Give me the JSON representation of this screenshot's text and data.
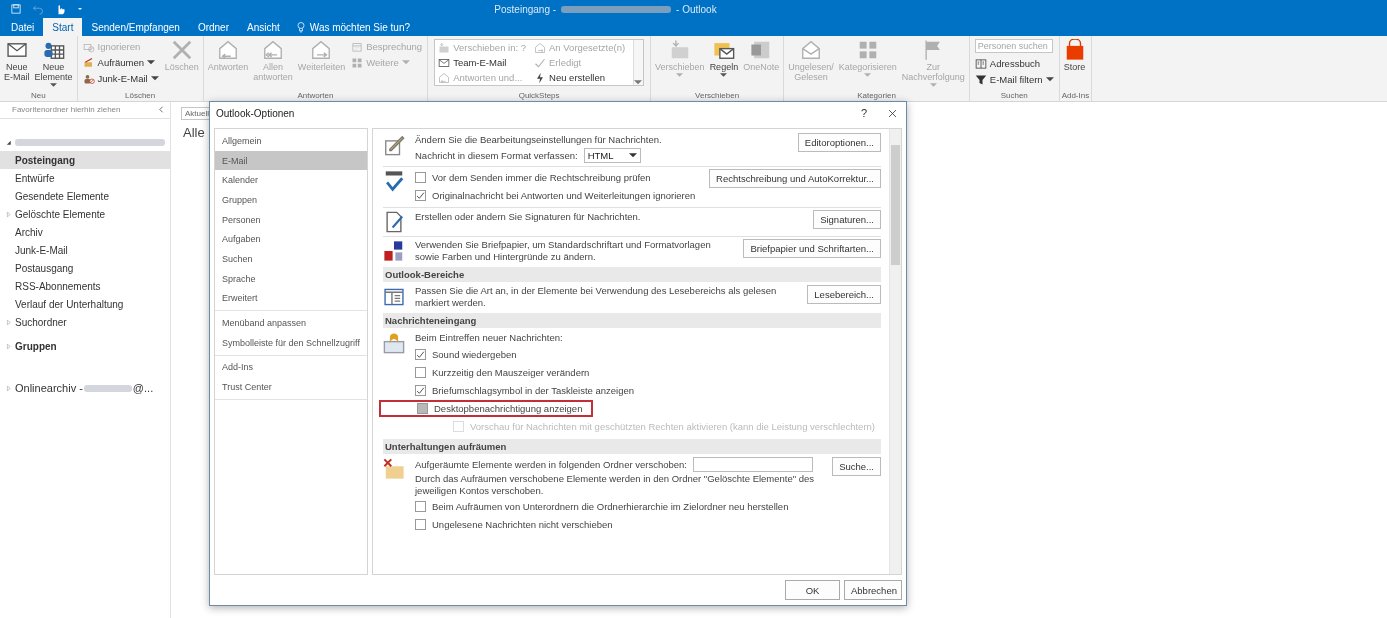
{
  "window": {
    "title_start": "Posteingang -",
    "title_end": "- Outlook"
  },
  "tabs": [
    {
      "label": "Datei",
      "selected": false
    },
    {
      "label": "Start",
      "selected": true
    },
    {
      "label": "Senden/Empfangen",
      "selected": false
    },
    {
      "label": "Ordner",
      "selected": false
    },
    {
      "label": "Ansicht",
      "selected": false
    }
  ],
  "tell_me": "Was möchten Sie tun?",
  "ribbon": {
    "groups": [
      {
        "label": "Neu",
        "items": [
          {
            "kind": "large",
            "label": "Neue\nE-Mail",
            "disabled": false
          },
          {
            "kind": "large",
            "label": "Neue\nElemente",
            "disabled": false,
            "dropdown": true
          }
        ]
      },
      {
        "label": "Löschen",
        "items": [
          {
            "kind": "stack",
            "items": [
              {
                "label": "Ignorieren",
                "disabled": true
              },
              {
                "label": "Aufräumen",
                "disabled": false,
                "dropdown": true
              },
              {
                "label": "Junk-E-Mail",
                "disabled": false,
                "dropdown": true
              }
            ]
          },
          {
            "kind": "large",
            "label": "Löschen",
            "disabled": true
          }
        ]
      },
      {
        "label": "Antworten",
        "items": [
          {
            "kind": "large",
            "label": "Antworten",
            "disabled": true
          },
          {
            "kind": "large",
            "label": "Allen\nantworten",
            "disabled": true
          },
          {
            "kind": "large",
            "label": "Weiterleiten",
            "disabled": true
          },
          {
            "kind": "stack",
            "items": [
              {
                "label": "Besprechung",
                "disabled": true
              },
              {
                "label": "Weitere",
                "disabled": true,
                "dropdown": true
              }
            ]
          }
        ]
      },
      {
        "label": "QuickSteps",
        "items": [
          {
            "kind": "gallery",
            "items": [
              {
                "label": "Verschieben in: ?",
                "disabled": true
              },
              {
                "label": "An Vorgesetzte(n)",
                "disabled": true
              },
              {
                "label": "Team-E-Mail",
                "disabled": false
              },
              {
                "label": "Erledigt",
                "disabled": true
              },
              {
                "label": "Antworten und...",
                "disabled": true
              },
              {
                "label": "Neu erstellen",
                "disabled": false
              }
            ]
          }
        ]
      },
      {
        "label": "Verschieben",
        "items": [
          {
            "kind": "large",
            "label": "Verschieben",
            "disabled": true,
            "dropdown": true
          },
          {
            "kind": "large",
            "label": "Regeln",
            "disabled": false,
            "dropdown": true
          },
          {
            "kind": "large",
            "label": "OneNote",
            "disabled": true
          }
        ]
      },
      {
        "label": "Kategorien",
        "items": [
          {
            "kind": "large",
            "label": "Ungelesen/\nGelesen",
            "disabled": true
          },
          {
            "kind": "large",
            "label": "Kategorisieren",
            "disabled": true,
            "dropdown": true
          },
          {
            "kind": "large",
            "label": "Zur\nNachverfolgung",
            "disabled": true,
            "dropdown": true
          }
        ]
      },
      {
        "label": "Suchen",
        "items": [
          {
            "kind": "search",
            "placeholder": "Personen suchen",
            "items": [
              {
                "label": "Adressbuch",
                "disabled": false
              },
              {
                "label": "E-Mail filtern",
                "disabled": false,
                "dropdown": true
              }
            ]
          }
        ]
      },
      {
        "label": "Add-Ins",
        "items": [
          {
            "kind": "large",
            "label": "Store",
            "disabled": false
          }
        ]
      }
    ]
  },
  "sidebar": {
    "favorites_hint": "Favoritenordner hierhin ziehen",
    "account_expanded": true,
    "folders": [
      {
        "label": "Posteingang",
        "selected": true,
        "expandable": false
      },
      {
        "label": "Entwürfe",
        "selected": false,
        "expandable": false
      },
      {
        "label": "Gesendete Elemente",
        "selected": false,
        "expandable": false
      },
      {
        "label": "Gelöschte Elemente",
        "selected": false,
        "expandable": true
      },
      {
        "label": "Archiv",
        "selected": false,
        "expandable": false
      },
      {
        "label": "Junk-E-Mail",
        "selected": false,
        "expandable": false
      },
      {
        "label": "Postausgang",
        "selected": false,
        "expandable": false
      },
      {
        "label": "RSS-Abonnements",
        "selected": false,
        "expandable": false
      },
      {
        "label": "Verlauf der Unterhaltung",
        "selected": false,
        "expandable": false
      },
      {
        "label": "Suchordner",
        "selected": false,
        "expandable": true
      }
    ],
    "groups": {
      "label": "Gruppen",
      "expandable": true
    },
    "archive": {
      "label_start": "Onlinearchiv -",
      "label_end": "@...",
      "expandable": true
    }
  },
  "message_list": {
    "filter": "Aktuell",
    "heading": "Alle"
  },
  "options_dialog": {
    "title": "Outlook-Optionen",
    "help": "?",
    "nav_groups": [
      [
        {
          "label": "Allgemein",
          "selected": false
        },
        {
          "label": "E-Mail",
          "selected": true
        },
        {
          "label": "Kalender",
          "selected": false
        },
        {
          "label": "Gruppen",
          "selected": false
        },
        {
          "label": "Personen",
          "selected": false
        },
        {
          "label": "Aufgaben",
          "selected": false
        },
        {
          "label": "Suchen",
          "selected": false
        },
        {
          "label": "Sprache",
          "selected": false
        },
        {
          "label": "Erweitert",
          "selected": false
        }
      ],
      [
        {
          "label": "Menüband anpassen",
          "selected": false
        },
        {
          "label": "Symbolleiste für den Schnellzugriff",
          "selected": false
        }
      ],
      [
        {
          "label": "Add-Ins",
          "selected": false
        },
        {
          "label": "Trust Center",
          "selected": false
        }
      ]
    ],
    "sections": [
      {
        "blocks": [
          {
            "button": "Editoroptionen...",
            "lines": [
              {
                "kind": "text",
                "text": "Ändern Sie die Bearbeitungseinstellungen für Nachrichten."
              },
              {
                "kind": "select",
                "label": "Nachricht in diesem Format verfassen:",
                "value": "HTML"
              }
            ]
          },
          {
            "button": "Rechtschreibung und AutoKorrektur...",
            "lines": [
              {
                "kind": "checkbox",
                "label": "Vor dem Senden immer die Rechtschreibung prüfen",
                "checked": false,
                "grayed": false,
                "highlighted": false,
                "disabled": false
              },
              {
                "kind": "checkbox",
                "label": "Originalnachricht bei Antworten und Weiterleitungen ignorieren",
                "checked": true,
                "grayed": false,
                "highlighted": false,
                "disabled": false
              }
            ]
          },
          {
            "button": "Signaturen...",
            "lines": [
              {
                "kind": "text",
                "text": "Erstellen oder ändern Sie Signaturen für Nachrichten."
              }
            ]
          },
          {
            "button": "Briefpapier und Schriftarten...",
            "lines": [
              {
                "kind": "text",
                "text": "Verwenden Sie Briefpapier, um Standardschriftart und Formatvorlagen sowie Farben und Hintergründe zu ändern."
              }
            ]
          }
        ]
      },
      {
        "header": "Outlook-Bereiche",
        "blocks": [
          {
            "button": "Lesebereich...",
            "lines": [
              {
                "kind": "text",
                "text": "Passen Sie die Art an, in der Elemente bei Verwendung des Lesebereichs als gelesen markiert werden."
              }
            ]
          }
        ]
      },
      {
        "header": "Nachrichteneingang",
        "blocks": [
          {
            "lines": [
              {
                "kind": "text",
                "text": "Beim Eintreffen neuer Nachrichten:"
              },
              {
                "kind": "checkbox",
                "label": "Sound wiedergeben",
                "checked": true,
                "grayed": false,
                "highlighted": false,
                "disabled": false
              },
              {
                "kind": "checkbox",
                "label": "Kurzzeitig den Mauszeiger verändern",
                "checked": false,
                "grayed": false,
                "highlighted": false,
                "disabled": false
              },
              {
                "kind": "checkbox",
                "label": "Briefumschlagsymbol in der Taskleiste anzeigen",
                "checked": true,
                "grayed": false,
                "highlighted": false,
                "disabled": false
              },
              {
                "kind": "checkbox",
                "label": "Desktopbenachrichtigung anzeigen",
                "checked": false,
                "grayed": true,
                "highlighted": true,
                "disabled": false,
                "children": [
                  {
                    "kind": "checkbox",
                    "label": "Vorschau für Nachrichten mit geschützten Rechten aktivieren (kann die Leistung verschlechtern)",
                    "checked": false,
                    "grayed": false,
                    "highlighted": false,
                    "disabled": true
                  }
                ]
              }
            ]
          }
        ]
      },
      {
        "header": "Unterhaltungen aufräumen",
        "blocks": [
          {
            "button": "Suche...",
            "lines": [
              {
                "kind": "field",
                "label": "Aufgeräumte Elemente werden in folgenden Ordner verschoben:"
              },
              {
                "kind": "text",
                "text": "Durch das Aufräumen verschobene Elemente werden in den Ordner \"Gelöschte Elemente\" des jeweiligen Kontos verschoben."
              },
              {
                "kind": "checkbox",
                "label": "Beim Aufräumen von Unterordnern die Ordnerhierarchie im Zielordner neu herstellen",
                "checked": false,
                "grayed": false,
                "highlighted": false,
                "disabled": false
              },
              {
                "kind": "checkbox",
                "label": "Ungelesene Nachrichten nicht verschieben",
                "checked": false,
                "grayed": false,
                "highlighted": false,
                "disabled": false
              }
            ]
          }
        ]
      }
    ],
    "footer_buttons": [
      "OK",
      "Abbrechen"
    ]
  }
}
